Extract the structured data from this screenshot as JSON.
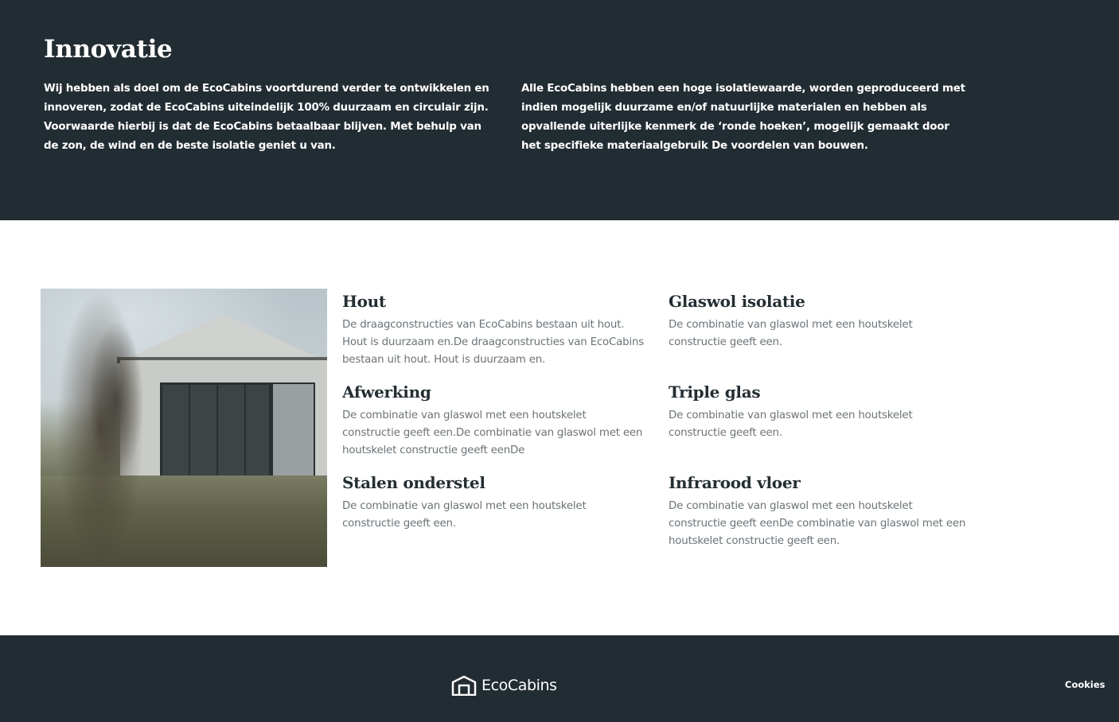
{
  "hero": {
    "title": "Innovatie",
    "left_text": "Wij hebben als doel om de EcoCabins voortdurend verder te ontwikkelen en innoveren, zodat de EcoCabins uiteindelijk 100% duurzaam en circulair zijn. Voorwaarde hierbij is dat de EcoCabins betaalbaar blijven. Met behulp van de zon, de wind en de beste isolatie geniet u van.",
    "right_text": "Alle EcoCabins hebben een hoge isolatiewaarde, worden geproduceerd met indien mogelijk duurzame en/of natuurlijke materialen en hebben als opvallende uiterlijke kenmerk de ‘ronde hoeken’, mogelijk gemaakt door het specifieke materiaalgebruik De voordelen van bouwen."
  },
  "features": [
    {
      "title": "Hout",
      "text": "De draagconstructies van EcoCabins bestaan uit hout. Hout is duurzaam en.De draagconstructies van EcoCabins bestaan uit hout. Hout is duurzaam en."
    },
    {
      "title": "Glaswol isolatie",
      "text": "De combinatie van glaswol met een houtskelet constructie geeft een."
    },
    {
      "title": "Afwerking",
      "text": "De combinatie van glaswol met een houtskelet constructie geeft een.De combinatie van glaswol met een houtskelet constructie geeft eenDe"
    },
    {
      "title": "Triple glas",
      "text": "De combinatie van glaswol met een houtskelet constructie geeft een."
    },
    {
      "title": "Stalen onderstel",
      "text": "De combinatie van glaswol met een houtskelet constructie geeft een."
    },
    {
      "title": "Infrarood vloer",
      "text": "De combinatie van glaswol met een houtskelet constructie geeft eenDe combinatie van glaswol met een houtskelet constructie geeft een."
    }
  ],
  "footer": {
    "logo_text": "EcoCabins",
    "cookies_label": "Cookies"
  },
  "colors": {
    "dark": "#222d33",
    "heading": "#242e33",
    "body_text": "#6b7377"
  }
}
